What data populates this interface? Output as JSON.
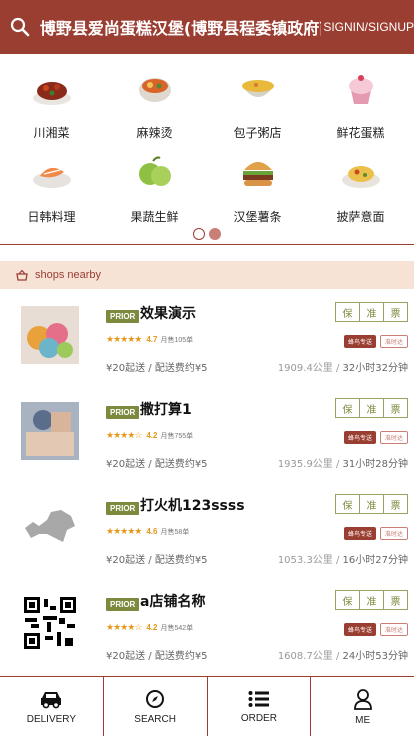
{
  "header": {
    "title": "博野县爱尚蛋糕汉堡(博野县程委镇政府南)",
    "signin": "SIGNIN/SIGNUP"
  },
  "categories": [
    {
      "label": "川湘菜",
      "icon": "chili-dish-icon"
    },
    {
      "label": "麻辣烫",
      "icon": "spicy-hotpot-icon"
    },
    {
      "label": "包子粥店",
      "icon": "porridge-bowl-icon"
    },
    {
      "label": "鲜花蛋糕",
      "icon": "cupcake-icon"
    },
    {
      "label": "日韩料理",
      "icon": "sushi-plate-icon"
    },
    {
      "label": "果蔬生鲜",
      "icon": "fruit-icon"
    },
    {
      "label": "汉堡薯条",
      "icon": "burger-icon"
    },
    {
      "label": "披萨意面",
      "icon": "pasta-icon"
    }
  ],
  "carousel": {
    "pages": 2,
    "active": 1
  },
  "nearby": {
    "label": "shops nearby"
  },
  "shops": [
    {
      "badge": "PRIOR",
      "name": "效果演示",
      "rating": 4.7,
      "stars": "★★★★★",
      "sales": "月售105单",
      "fees": "¥20起送 / 配送费约¥5",
      "distance": "1909.4公里",
      "time": "32小时32分钟",
      "tags": [
        "保",
        "准",
        "票"
      ],
      "delivery": "蜂鸟专送",
      "ontime": "准时达"
    },
    {
      "badge": "PRIOR",
      "name": "撒打算1",
      "rating": 4.2,
      "stars": "★★★★☆",
      "sales": "月售755单",
      "fees": "¥20起送 / 配送费约¥5",
      "distance": "1935.9公里",
      "time": "31小时28分钟",
      "tags": [
        "保",
        "准",
        "票"
      ],
      "delivery": "蜂鸟专送",
      "ontime": "准时达"
    },
    {
      "badge": "PRIOR",
      "name": "打火机123ssss",
      "rating": 4.6,
      "stars": "★★★★★",
      "sales": "月售58单",
      "fees": "¥20起送 / 配送费约¥5",
      "distance": "1053.3公里",
      "time": "16小时27分钟",
      "tags": [
        "保",
        "准",
        "票"
      ],
      "delivery": "蜂鸟专送",
      "ontime": "准时达"
    },
    {
      "badge": "PRIOR",
      "name": "a店铺名称",
      "rating": 4.2,
      "stars": "★★★★☆",
      "sales": "月售542单",
      "fees": "¥20起送 / 配送费约¥5",
      "distance": "1608.7公里",
      "time": "24小时53分钟",
      "tags": [
        "保",
        "准",
        "票"
      ],
      "delivery": "蜂鸟专送",
      "ontime": "准时达"
    }
  ],
  "nav": [
    {
      "label": "DELIVERY",
      "icon": "car-icon"
    },
    {
      "label": "SEARCH",
      "icon": "compass-icon"
    },
    {
      "label": "ORDER",
      "icon": "list-icon"
    },
    {
      "label": "ME",
      "icon": "person-icon"
    }
  ],
  "colors": {
    "brand": "#9b3e32",
    "accent": "#c97e76",
    "prior": "#7c8a3d"
  }
}
